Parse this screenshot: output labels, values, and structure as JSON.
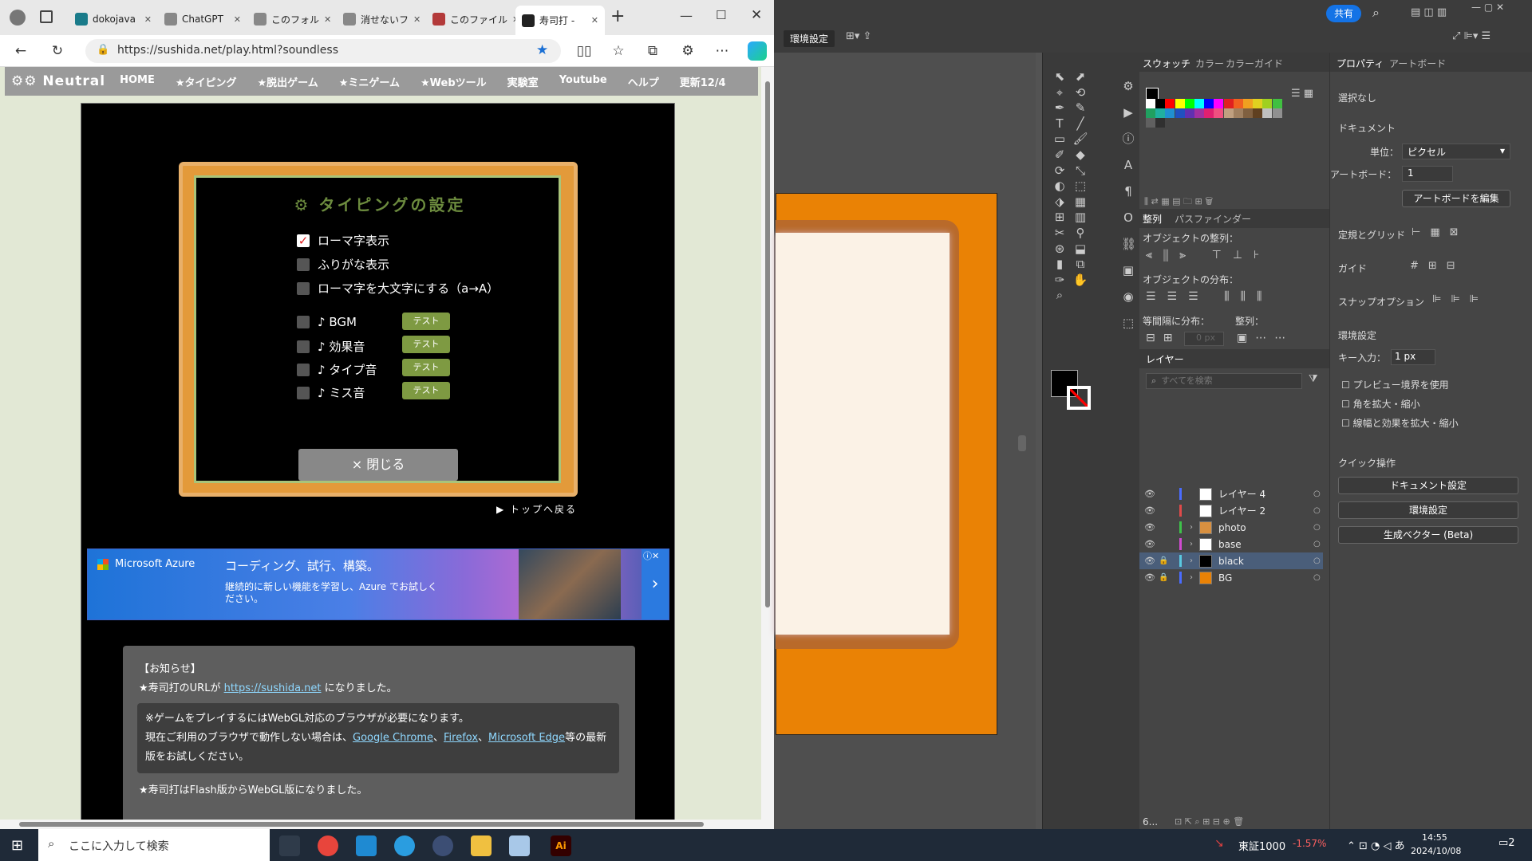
{
  "browser": {
    "tabs": [
      {
        "label": "dokojava",
        "color": "#1a7b8a",
        "active": false
      },
      {
        "label": "ChatGPT",
        "color": "#888888",
        "active": false
      },
      {
        "label": "このフォル",
        "color": "#888888",
        "active": false
      },
      {
        "label": "消せないフ",
        "color": "#888888",
        "active": false
      },
      {
        "label": "このファイル",
        "color": "#b33a3a",
        "active": false
      },
      {
        "label": "寿司打 -",
        "color": "#222222",
        "active": true
      }
    ],
    "url": "https://sushida.net/play.html?soundless",
    "site_nav": {
      "logo": "Neutral",
      "items": [
        "HOME",
        "★タイピング",
        "★脱出ゲーム",
        "★ミニゲーム",
        "★Webツール",
        "実験室",
        "Youtube",
        "ヘルプ",
        "更新12/4"
      ]
    },
    "settings": {
      "title": "タイピングの設定",
      "options": [
        {
          "label": "ローマ字表示",
          "checked": true
        },
        {
          "label": "ふりがな表示",
          "checked": false
        },
        {
          "label": "ローマ字を大文字にする（a→A）",
          "checked": false
        }
      ],
      "sound_options": [
        {
          "label": "♪ BGM",
          "button": "テスト"
        },
        {
          "label": "♪ 効果音",
          "button": "テスト"
        },
        {
          "label": "♪ タイプ音",
          "button": "テスト"
        },
        {
          "label": "♪ ミス音",
          "button": "テスト"
        }
      ],
      "close_label": "× 閉じる",
      "top_link": "▶ トップへ戻る"
    },
    "ad": {
      "brand": "Microsoft Azure",
      "headline": "コーディング、試行、構築。",
      "body": "継続的に新しい機能を学習し、Azure でお試しください。"
    },
    "notice": {
      "heading": "【お知らせ】",
      "line1_prefix": "★寿司打のURLが",
      "line1_link": "https://sushida.net",
      "line1_suffix": "になりました。",
      "box_line1": "※ゲームをプレイするにはWebGL対応のブラウザが必要になります。",
      "box_line2_prefix": "現在ご利用のブラウザで動作しない場合は、",
      "link_chrome": "Google Chrome",
      "link_firefox": "Firefox",
      "link_edge": "Microsoft Edge",
      "box_line2_suffix": "等の最新版をお試しください。",
      "line_last": "★寿司打はFlash版からWebGL版になりました。"
    }
  },
  "illustrator": {
    "top": {
      "share": "共有",
      "env": "環境設定"
    },
    "swatches_tabs": [
      "スウォッチ",
      "カラー",
      "カラーガイド"
    ],
    "align_tabs": [
      "整列",
      "パスファインダー"
    ],
    "align_labels": {
      "align_objects": "オブジェクトの整列：",
      "distribute_objects": "オブジェクトの分布：",
      "distribute_spacing": "等間隔に分布：",
      "align_to": "整列：",
      "spacing_value": "0 px"
    },
    "layers_tab": "レイヤー",
    "layers_search": "すべてを検索",
    "layers": [
      {
        "name": "レイヤー 4",
        "color": "#4a6cff",
        "thumb": "#ffffff",
        "locked": false,
        "expand": false,
        "selected": false
      },
      {
        "name": "レイヤー 2",
        "color": "#e04a4a",
        "thumb": "#ffffff",
        "locked": false,
        "expand": false,
        "selected": false
      },
      {
        "name": "photo",
        "color": "#3ec24a",
        "thumb": "#d89040",
        "locked": false,
        "expand": true,
        "selected": false
      },
      {
        "name": "base",
        "color": "#d04ad0",
        "thumb": "#ffffff",
        "locked": false,
        "expand": true,
        "selected": false
      },
      {
        "name": "black",
        "color": "#5ac8e0",
        "thumb": "#000000",
        "locked": true,
        "expand": true,
        "selected": true
      },
      {
        "name": "BG",
        "color": "#4a6cff",
        "thumb": "#ea8205",
        "locked": true,
        "expand": true,
        "selected": false
      }
    ],
    "layers_count": "6...",
    "props": {
      "tabs": [
        "プロパティ",
        "アートボード"
      ],
      "no_selection": "選択なし",
      "document": "ドキュメント",
      "unit_label": "単位：",
      "unit_value": "ピクセル",
      "artboard_label": "アートボード：",
      "artboard_value": "1",
      "edit_artboard": "アートボードを編集",
      "rulers_grid": "定規とグリッド",
      "guides": "ガイド",
      "snap": "スナップオプション",
      "prefs": "環境設定",
      "key_input_label": "キー入力：",
      "key_input_value": "1 px",
      "preview_bounds": "プレビュー境界を使用",
      "scale_corners": "角を拡大・縮小",
      "scale_strokes": "線幅と効果を拡大・縮小",
      "quick_actions": "クイック操作",
      "doc_setup": "ドキュメント設定",
      "prefs_btn": "環境設定",
      "gen_vector": "生成ベクター (Beta)"
    }
  },
  "taskbar": {
    "search_placeholder": "ここに入力して検索",
    "stock_name": "東証1000",
    "stock_change": "-1.57%",
    "time": "14:55",
    "date": "2024/10/08",
    "notif_count": "2"
  }
}
